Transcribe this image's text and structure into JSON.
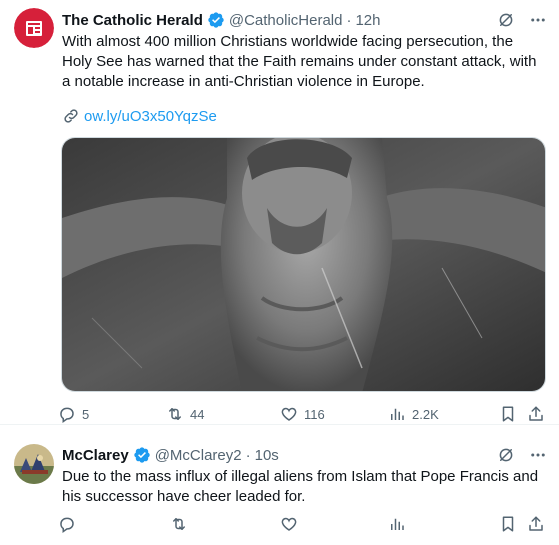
{
  "tweets": [
    {
      "author_name": "The Catholic Herald",
      "handle": "@CatholicHerald",
      "separator": "·",
      "time": "12h",
      "text": "With almost 400 million Christians worldwide facing persecution, the Holy See has warned that the Faith remains under constant attack, with a notable increase in anti-Christian violence in Europe.",
      "link": "ow.ly/uO3x50YqzSe",
      "stats": {
        "replies": "5",
        "reposts": "44",
        "likes": "116",
        "views": "2.2K"
      }
    },
    {
      "author_name": "McClarey",
      "handle": "@McClarey2",
      "separator": "·",
      "time": "10s",
      "text": "Due to the mass influx of illegal aliens from Islam that Pope Francis and his successor have cheer leaded for.",
      "stats": {
        "replies": "",
        "reposts": "",
        "likes": "",
        "views": ""
      }
    }
  ],
  "colors": {
    "text": "#0f1419",
    "muted": "#536471",
    "link": "#1d9bf0",
    "verified": "#1d9bf0",
    "herald_red": "#d6203a"
  },
  "icons": [
    "verified-badge-icon",
    "grok-icon",
    "more-icon",
    "link-icon",
    "reply-icon",
    "repost-icon",
    "like-icon",
    "views-icon",
    "bookmark-icon",
    "share-icon"
  ]
}
